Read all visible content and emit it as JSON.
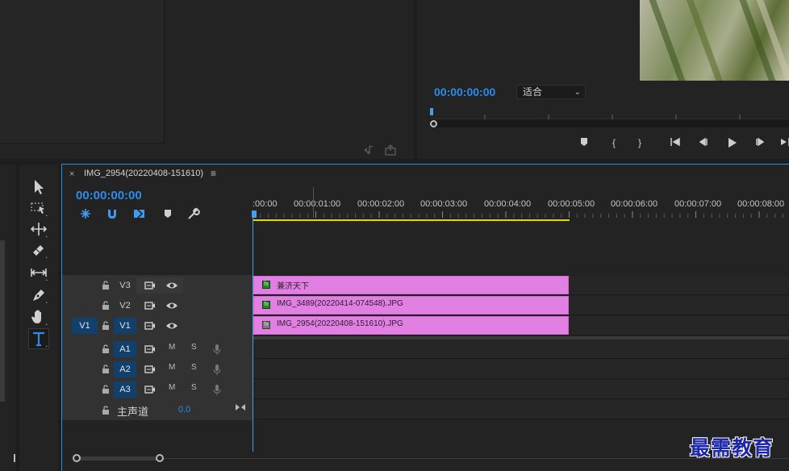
{
  "program_monitor": {
    "timecode": "00:00:00:00",
    "fit_select": "适合",
    "transport": [
      "marker",
      "mark-in",
      "mark-out",
      "go-to-in",
      "step-back",
      "play",
      "step-forward",
      "go-to-out"
    ]
  },
  "timeline": {
    "tab_close": "×",
    "tab_title": "IMG_2954(20220408-151610)",
    "tab_menu": "≡",
    "timecode": "00:00:00:00",
    "ruler_labels": [
      ":00:00",
      "00:00:01:00",
      "00:00:02:00",
      "00:00:03:00",
      "00:00:04:00",
      "00:00:05:00",
      "00:00:06:00",
      "00:00:07:00",
      "00:00:08:00"
    ],
    "video_tracks": [
      {
        "name": "V3",
        "clip": "兼济天下",
        "fx_color": "green"
      },
      {
        "name": "V2",
        "clip": "IMG_3489(20220414-074548).JPG",
        "fx_color": "green"
      },
      {
        "name": "V1",
        "clip": "IMG_2954(20220408-151610).JPG",
        "fx_color": "gray",
        "source_patch": "V1"
      }
    ],
    "audio_tracks": [
      {
        "name": "A1",
        "m": "M",
        "s": "S"
      },
      {
        "name": "A2",
        "m": "M",
        "s": "S"
      },
      {
        "name": "A3",
        "m": "M",
        "s": "S"
      }
    ],
    "master": {
      "label": "主声道",
      "value": "0.0"
    }
  },
  "tools": [
    "selection-tool",
    "track-select-tool",
    "ripple-edit-tool",
    "razor-tool",
    "slip-tool",
    "pen-tool",
    "hand-tool",
    "type-tool"
  ],
  "watermark": "最需教育",
  "colors": {
    "accent": "#2d8ceb",
    "clip": "#e27fe3",
    "work_area": "#e9d300",
    "track_active": "#12406c"
  }
}
